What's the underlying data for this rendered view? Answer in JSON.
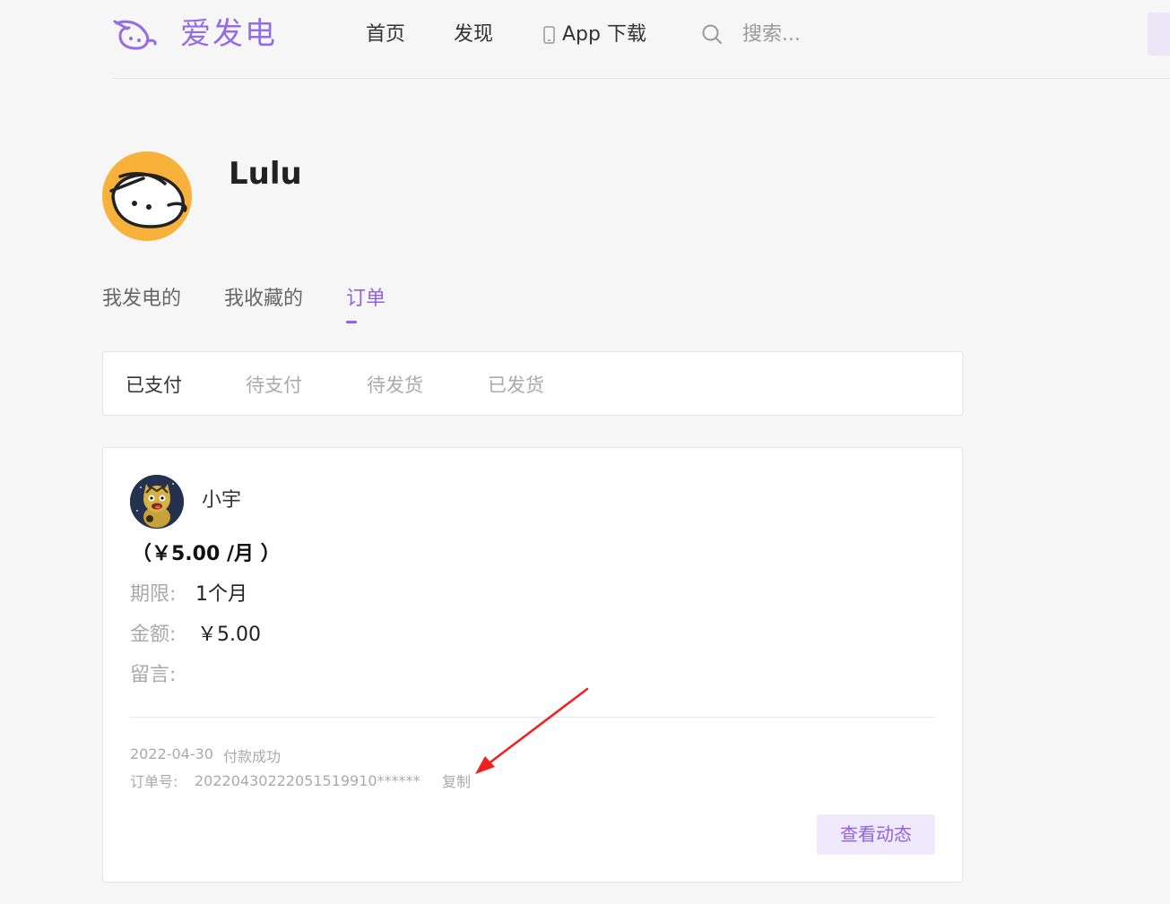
{
  "header": {
    "brand": "爱发电",
    "nav": {
      "home": "首页",
      "discover": "发现",
      "app_download": "App 下载"
    },
    "search_placeholder": "搜索..."
  },
  "profile": {
    "username": "Lulu",
    "tabs": {
      "mine": "我发电的",
      "favorites": "我收藏的",
      "orders": "订单"
    }
  },
  "order_status_tabs": [
    {
      "label": "已支付",
      "active": true
    },
    {
      "label": "待支付",
      "active": false
    },
    {
      "label": "待发货",
      "active": false
    },
    {
      "label": "已发货",
      "active": false
    }
  ],
  "order": {
    "creator_name": "小宇",
    "plan_price": "（￥5.00 /月 ）",
    "duration_label": "期限:",
    "duration_value": "1个月",
    "amount_label": "金额:",
    "amount_value": "￥5.00",
    "message_label": "留言:",
    "date": "2022-04-30",
    "payment_status": "付款成功",
    "order_number_label": "订单号:",
    "order_number": "20220430222051519910******",
    "copy_label": "复制",
    "view_button": "查看动态"
  },
  "colors": {
    "brand_purple": "#8f62e0",
    "annotation_red": "#f02020",
    "avatar_orange": "#f8b23b"
  }
}
